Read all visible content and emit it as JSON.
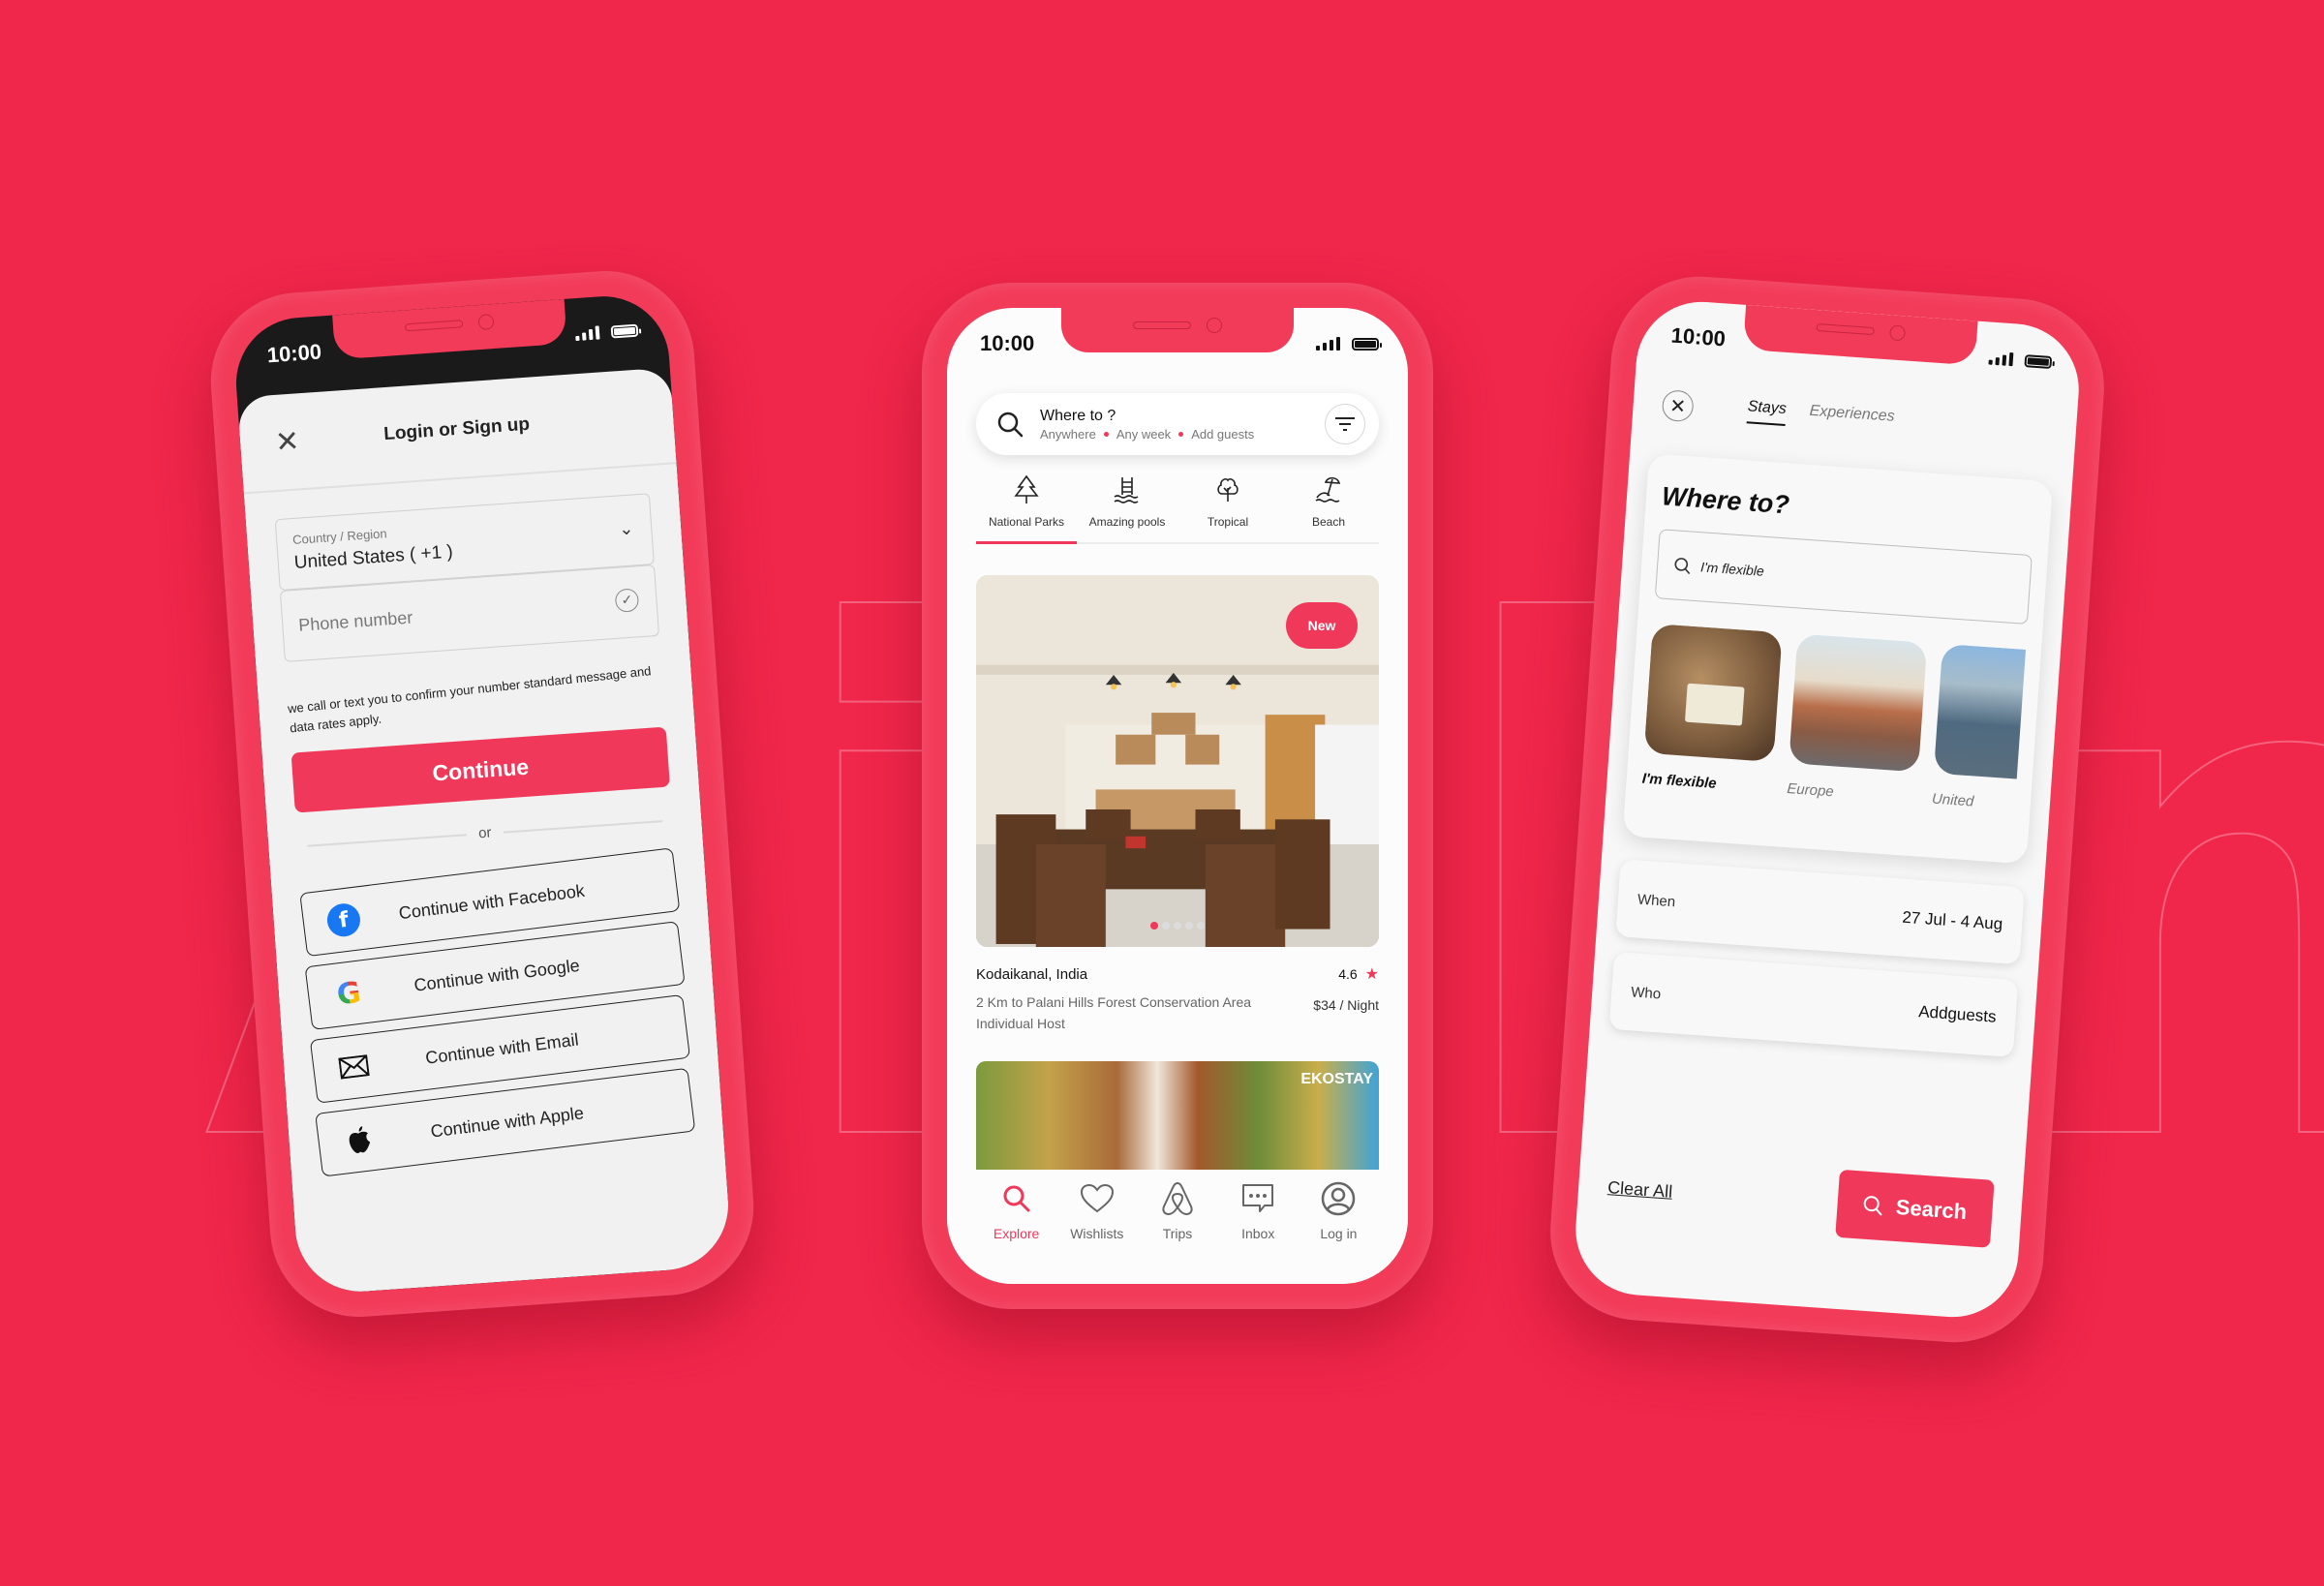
{
  "brand": {
    "watermark": "Airbnb",
    "accent": "#F0385A",
    "background": "#F0264B"
  },
  "login_screen": {
    "status_time": "10:00",
    "title": "Login or Sign up",
    "country_label": "Country  / Region",
    "country_value": "United States ( +1 )",
    "phone_placeholder": "Phone number",
    "disclaimer": "we call or text you to confirm your number standard message and data rates apply.",
    "continue_label": "Continue",
    "divider_label": "or",
    "social_buttons": [
      {
        "icon": "facebook-icon",
        "label": "Continue with Facebook"
      },
      {
        "icon": "google-icon",
        "label": "Continue with Google"
      },
      {
        "icon": "email-icon",
        "label": "Continue with Email"
      },
      {
        "icon": "apple-icon",
        "label": "Continue with Apple"
      }
    ]
  },
  "explore_screen": {
    "status_time": "10:00",
    "search": {
      "title": "Where to ?",
      "chips": [
        "Anywhere",
        "Any week",
        "Add guests"
      ]
    },
    "categories": [
      {
        "icon": "pine-tree-icon",
        "label": "National Parks",
        "active": true
      },
      {
        "icon": "pool-ladder-icon",
        "label": "Amazing pools",
        "active": false
      },
      {
        "icon": "tree-icon",
        "label": "Tropical",
        "active": false
      },
      {
        "icon": "beach-umbrella-icon",
        "label": "Beach",
        "active": false
      }
    ],
    "listing": {
      "badge": "New",
      "image_count": 5,
      "active_image": 1,
      "location": "Kodaikanal, India",
      "rating": "4.6",
      "description": "2 Km to Palani Hills Forest Conservation Area Individual Host",
      "price": "$34 / Night"
    },
    "listing2": {
      "watermark": "EKOSTAY"
    },
    "nav": [
      {
        "icon": "search-icon",
        "label": "Explore",
        "active": true
      },
      {
        "icon": "heart-icon",
        "label": "Wishlists",
        "active": false
      },
      {
        "icon": "airbnb-logo-icon",
        "label": "Trips",
        "active": false
      },
      {
        "icon": "chat-icon",
        "label": "Inbox",
        "active": false
      },
      {
        "icon": "user-circle-icon",
        "label": "Log in",
        "active": false
      }
    ]
  },
  "search_screen": {
    "status_time": "10:00",
    "tabs": [
      {
        "label": "Stays",
        "active": true
      },
      {
        "label": "Experiences",
        "active": false
      }
    ],
    "where_title": "Where to?",
    "where_placeholder": "I'm flexible",
    "destinations": [
      {
        "label": "I'm flexible",
        "active": true
      },
      {
        "label": "Europe",
        "active": false
      },
      {
        "label": "United",
        "active": false
      }
    ],
    "when": {
      "label": "When",
      "value": "27 Jul - 4 Aug"
    },
    "who": {
      "label": "Who",
      "value": "Addguests"
    },
    "clear_all": "Clear All",
    "search_label": "Search"
  }
}
